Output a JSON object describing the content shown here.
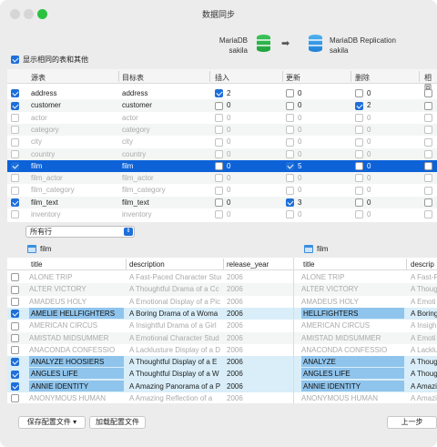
{
  "window": {
    "title": "数据同步"
  },
  "compare": {
    "source_line1": "MariaDB",
    "source_line2": "sakila",
    "target_line1": "MariaDB Replication",
    "target_line2": "sakila",
    "source_color": "#2bb84d",
    "target_color": "#2d8fe3"
  },
  "show_same_label": "显示相同的表和其他",
  "table1": {
    "headers": [
      "源表",
      "目标表",
      "插入",
      "更新",
      "删除",
      "相同"
    ],
    "rows": [
      {
        "checked": true,
        "src": "address",
        "tgt": "address",
        "ins": "2",
        "ins_on": true,
        "upd": "0",
        "upd_on": false,
        "del": "0",
        "del_on": false,
        "dim": false
      },
      {
        "checked": true,
        "src": "customer",
        "tgt": "customer",
        "ins": "0",
        "ins_on": false,
        "upd": "0",
        "upd_on": false,
        "del": "2",
        "del_on": true,
        "dim": false
      },
      {
        "checked": false,
        "src": "actor",
        "tgt": "actor",
        "ins": "0",
        "ins_on": false,
        "upd": "0",
        "upd_on": false,
        "del": "0",
        "del_on": false,
        "dim": true
      },
      {
        "checked": false,
        "src": "category",
        "tgt": "category",
        "ins": "0",
        "ins_on": false,
        "upd": "0",
        "upd_on": false,
        "del": "0",
        "del_on": false,
        "dim": true
      },
      {
        "checked": false,
        "src": "city",
        "tgt": "city",
        "ins": "0",
        "ins_on": false,
        "upd": "0",
        "upd_on": false,
        "del": "0",
        "del_on": false,
        "dim": true
      },
      {
        "checked": false,
        "src": "country",
        "tgt": "country",
        "ins": "0",
        "ins_on": false,
        "upd": "0",
        "upd_on": false,
        "del": "0",
        "del_on": false,
        "dim": true
      },
      {
        "checked": true,
        "src": "film",
        "tgt": "film",
        "ins": "0",
        "ins_on": false,
        "upd": "5",
        "upd_on": true,
        "del": "0",
        "del_on": false,
        "dim": false,
        "selected": true
      },
      {
        "checked": false,
        "src": "film_actor",
        "tgt": "film_actor",
        "ins": "0",
        "ins_on": false,
        "upd": "0",
        "upd_on": false,
        "del": "0",
        "del_on": false,
        "dim": true
      },
      {
        "checked": false,
        "src": "film_category",
        "tgt": "film_category",
        "ins": "0",
        "ins_on": false,
        "upd": "0",
        "upd_on": false,
        "del": "0",
        "del_on": false,
        "dim": true
      },
      {
        "checked": true,
        "src": "film_text",
        "tgt": "film_text",
        "ins": "0",
        "ins_on": false,
        "upd": "3",
        "upd_on": true,
        "del": "0",
        "del_on": false,
        "dim": false
      },
      {
        "checked": false,
        "src": "inventory",
        "tgt": "inventory",
        "ins": "0",
        "ins_on": false,
        "upd": "0",
        "upd_on": false,
        "del": "0",
        "del_on": false,
        "dim": true
      }
    ]
  },
  "filter": {
    "selected": "所有行"
  },
  "left_panel": {
    "title": "film",
    "headers": [
      "title",
      "description",
      "release_year"
    ]
  },
  "right_panel": {
    "title": "film",
    "headers": [
      "title",
      "descrip"
    ]
  },
  "table2": {
    "rows": [
      {
        "checked": false,
        "title": "ALONE TRIP",
        "desc": "A Fast-Paced Character Stud",
        "year": "2006",
        "r_title": "ALONE TRIP",
        "r_desc": "A Fast-P",
        "diff": false
      },
      {
        "checked": false,
        "title": "ALTER VICTORY",
        "desc": "A Thoughtful Drama of a Cc",
        "year": "2006",
        "r_title": "ALTER VICTORY",
        "r_desc": "A Thoug",
        "diff": false
      },
      {
        "checked": false,
        "title": "AMADEUS HOLY",
        "desc": "A Emotional Display of a Pic",
        "year": "2006",
        "r_title": "AMADEUS HOLY",
        "r_desc": "A Emoti",
        "diff": false
      },
      {
        "checked": true,
        "title": "AMELIE HELLFIGHTERS",
        "desc": "A Boring Drama of a Woma",
        "year": "2006",
        "r_title": "HELLFIGHTERS",
        "r_desc": "A Boring",
        "diff": true
      },
      {
        "checked": false,
        "title": "AMERICAN CIRCUS",
        "desc": "A Insightful Drama of a Girl",
        "year": "2006",
        "r_title": "AMERICAN CIRCUS",
        "r_desc": "A Insigh",
        "diff": false
      },
      {
        "checked": false,
        "title": "AMISTAD MIDSUMMER",
        "desc": "A Emotional Character Stud",
        "year": "2006",
        "r_title": "AMISTAD MIDSUMMER",
        "r_desc": "A Emoti",
        "diff": false
      },
      {
        "checked": false,
        "title": "ANACONDA CONFESSIO",
        "desc": "A Lacklusture Display of a D",
        "year": "2006",
        "r_title": "ANACONDA CONFESSIO",
        "r_desc": "A Lacklu",
        "diff": false
      },
      {
        "checked": true,
        "title": "ANALYZE HOOSIERS",
        "desc": "A Thoughtful Display of a E",
        "year": "2006",
        "r_title": "ANALYZE",
        "r_desc": "A Thoug",
        "diff": true
      },
      {
        "checked": true,
        "title": "ANGLES LIFE",
        "desc": "A Thoughtful Display of a W",
        "year": "2006",
        "r_title": "ANGLES LIFE",
        "r_desc": "A Thoug",
        "diff": true
      },
      {
        "checked": true,
        "title": "ANNIE IDENTITY",
        "desc": "A Amazing Panorama of a P",
        "year": "2006",
        "r_title": "ANNIE IDENTITY",
        "r_desc": "A Amazi",
        "diff": true
      },
      {
        "checked": false,
        "title": "ANONYMOUS HUMAN",
        "desc": "A Amazing Reflection of a",
        "year": "2006",
        "r_title": "ANONYMOUS HUMAN",
        "r_desc": "A Amazi",
        "diff": false
      }
    ]
  },
  "footer": {
    "save_profile": "保存配置文件",
    "load_profile": "加载配置文件",
    "back": "上一步"
  }
}
